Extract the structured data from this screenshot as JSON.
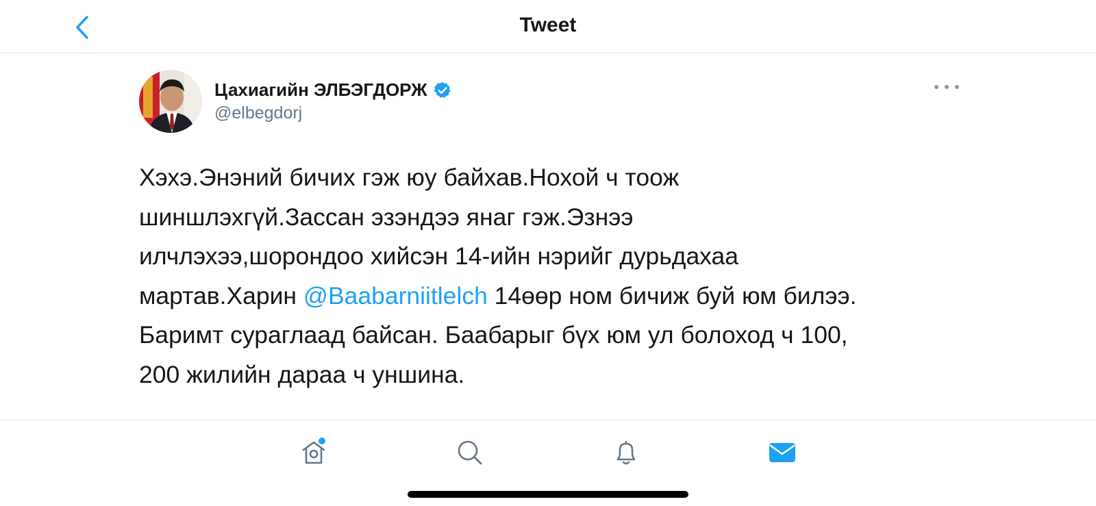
{
  "header": {
    "title": "Tweet",
    "back_icon": "chevron-left-icon"
  },
  "tweet": {
    "author": {
      "name": "Цахиагийн ЭЛБЭГДОРЖ",
      "handle": "@elbegdorj",
      "verified": true
    },
    "text_lines": [
      {
        "before": "Хэхэ.Энэний бичих гэж юу байхав.Нохой ч тоож",
        "mention": "",
        "after": ""
      },
      {
        "before": "шиншлэхгүй.Зассан эзэндээ янаг гэж.Эзнээ",
        "mention": "",
        "after": ""
      },
      {
        "before": "илчлэхээ,шорондоо хийсэн 14-ийн нэрийг дурьдахаа",
        "mention": "",
        "after": ""
      },
      {
        "before": "мартав.Харин ",
        "mention": "@Baabarniitlelch",
        "after": " 14өөр ном бичиж буй юм билээ."
      },
      {
        "before": "Баримт сураглаад байсан. Баабарыг бүх юм ул болоход ч 100,",
        "mention": "",
        "after": ""
      },
      {
        "before": "200 жилийн дараа ч уншина.",
        "mention": "",
        "after": ""
      }
    ]
  },
  "tabbar": {
    "items": [
      {
        "icon": "home-icon",
        "has_notification_dot": true,
        "active": false
      },
      {
        "icon": "search-icon",
        "active": false
      },
      {
        "icon": "bell-icon",
        "active": false
      },
      {
        "icon": "mail-icon",
        "active": true
      }
    ]
  },
  "colors": {
    "accent": "#1da1f2",
    "text": "#14171a",
    "secondary_text": "#657786",
    "divider": "#e1e4e8",
    "icon_inactive": "#657786"
  }
}
